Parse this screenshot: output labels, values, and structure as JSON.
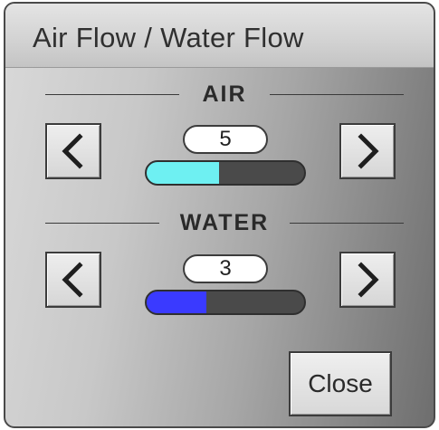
{
  "dialog": {
    "title": "Air Flow / Water Flow",
    "close_label": "Close"
  },
  "air": {
    "label": "AIR",
    "value": "5",
    "level_fraction": 0.46,
    "fill_color": "#6ef0f2",
    "decrease_icon": "chevron-left-icon",
    "increase_icon": "chevron-right-icon"
  },
  "water": {
    "label": "WATER",
    "value": "3",
    "level_fraction": 0.38,
    "fill_color": "#3a3aff",
    "decrease_icon": "chevron-left-icon",
    "increase_icon": "chevron-right-icon"
  }
}
